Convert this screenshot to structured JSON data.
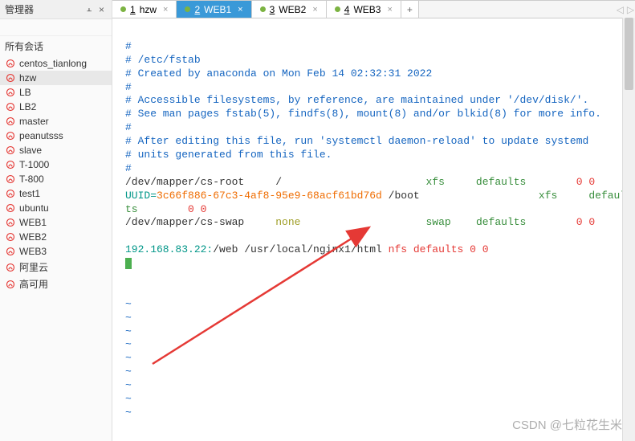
{
  "sidebar": {
    "title": "管理器",
    "sessions_label": "所有会话",
    "search_placeholder": "",
    "items": [
      {
        "label": "centos_tianlong"
      },
      {
        "label": "hzw"
      },
      {
        "label": "LB"
      },
      {
        "label": "LB2"
      },
      {
        "label": "master"
      },
      {
        "label": "peanutsss"
      },
      {
        "label": "slave"
      },
      {
        "label": "T-1000"
      },
      {
        "label": "T-800"
      },
      {
        "label": "test1"
      },
      {
        "label": "ubuntu"
      },
      {
        "label": "WEB1"
      },
      {
        "label": "WEB2"
      },
      {
        "label": "WEB3"
      },
      {
        "label": "阿里云"
      },
      {
        "label": "高可用"
      }
    ]
  },
  "tabs": {
    "items": [
      {
        "num": "1",
        "label": "hzw",
        "active": false
      },
      {
        "num": "2",
        "label": "WEB1",
        "active": true
      },
      {
        "num": "3",
        "label": "WEB2",
        "active": false
      },
      {
        "num": "4",
        "label": "WEB3",
        "active": false
      }
    ],
    "add": "+"
  },
  "terminal": {
    "l1": "#",
    "l2": "# /etc/fstab",
    "l3": "# Created by anaconda on Mon Feb 14 02:32:31 2022",
    "l4": "#",
    "l5": "# Accessible filesystems, by reference, are maintained under '/dev/disk/'.",
    "l6": "# See man pages fstab(5), findfs(8), mount(8) and/or blkid(8) for more info.",
    "l7": "#",
    "l8": "# After editing this file, run 'systemctl daemon-reload' to update systemd",
    "l9": "# units generated from this file.",
    "l10": "#",
    "root_dev": "/dev/mapper/cs-root",
    "root_mount": "/",
    "root_fs": "xfs",
    "root_opts": "defaults",
    "root_dump": "0 0",
    "uuid_prefix": "UUID=",
    "uuid_val": "3c66f886-67c3-4af8-95e9-68acf61bd76d",
    "boot_mount": " /boot",
    "boot_fs": "xfs",
    "boot_opts_a": "defaul",
    "boot_opts_b": "ts",
    "boot_dump": "0 0",
    "swap_dev": "/dev/mapper/cs-swap",
    "swap_none": "none",
    "swap_fs": "swap",
    "swap_opts": "defaults",
    "swap_dump": "0 0",
    "nfs_ip": "192.168.83.22:",
    "nfs_src": "/web ",
    "nfs_dst": "/usr/local/nginx1/html",
    "nfs_tail": " nfs defaults 0 0",
    "tilde": "~"
  },
  "watermark": "CSDN @七粒花生米"
}
